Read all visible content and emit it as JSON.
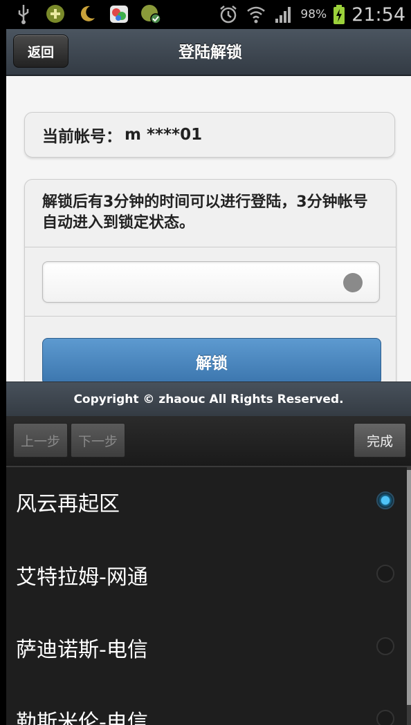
{
  "status_bar": {
    "battery_text": "98%",
    "time": "21:54",
    "icons": [
      "usb-icon",
      "plus-icon",
      "moon-icon",
      "gamecenter-icon",
      "app-icon",
      "alarm-icon",
      "wifi-icon",
      "signal-icon",
      "battery-charging-icon"
    ]
  },
  "header": {
    "back_label": "返回",
    "title": "登陆解锁"
  },
  "account": {
    "label": "当前帐号：",
    "value": "m ****01"
  },
  "notice": "解锁后有3分钟的时间可以进行登陆，3分钟帐号自动进入到锁定状态。",
  "unlock_label": "解锁",
  "footer_text": "Copyright © zhaouc All Rights Reserved.",
  "picker": {
    "prev_label": "上一步",
    "next_label": "下一步",
    "done_label": "完成",
    "items": [
      {
        "label": "风云再起区",
        "selected": true
      },
      {
        "label": "艾特拉姆-网通",
        "selected": false
      },
      {
        "label": "萨迪诺斯-电信",
        "selected": false
      },
      {
        "label": "勒斯米伦-电信",
        "selected": false
      }
    ]
  },
  "colors": {
    "accent": "#4b8cc8",
    "header": "#3c454f",
    "picker_bg": "#1e1e1e"
  }
}
